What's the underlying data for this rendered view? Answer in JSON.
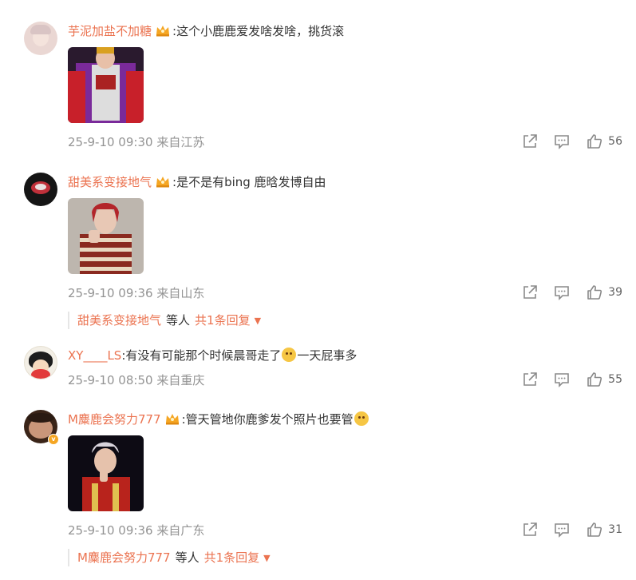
{
  "top_peek": {
    "username": "",
    "text": ""
  },
  "colors": {
    "username": "#eb7350",
    "meta": "#939393",
    "text": "#333333",
    "badge": "#f5a623"
  },
  "icons": {
    "share": "share-icon",
    "comment": "comment-icon",
    "like": "thumbs-up-icon"
  },
  "comments": [
    {
      "username": "芋泥加盐不加糖",
      "text": ":这个小鹿鹿爱发啥发啥，挑货滚",
      "date": "25-9-10 09:30",
      "location": "来自江苏",
      "likes": "56",
      "has_image": true,
      "has_crown": true
    },
    {
      "username": "甜美系变接地气",
      "text": ":是不是有bing 鹿晗发博自由",
      "date": "25-9-10 09:36",
      "location": "来自山东",
      "likes": "39",
      "has_image": true,
      "has_crown": true,
      "reply_summary": {
        "who": "甜美系变接地气",
        "etc": "等人",
        "count": "共1条回复"
      }
    },
    {
      "username": "XY____LS",
      "text_before": ":有没有可能那个时候晨哥走了",
      "text_after": "一天屁事多",
      "date": "25-9-10 08:50",
      "location": "来自重庆",
      "likes": "55",
      "has_image": false,
      "has_crown": false
    },
    {
      "username": "M麋鹿会努力777",
      "text": ":管天管地你鹿爹发个照片也要管",
      "date": "25-9-10 09:36",
      "location": "来自广东",
      "likes": "31",
      "has_image": true,
      "has_crown": true,
      "verified": true,
      "reply_summary": {
        "who": "M麋鹿会努力777",
        "etc": "等人",
        "count": "共1条回复"
      }
    }
  ]
}
